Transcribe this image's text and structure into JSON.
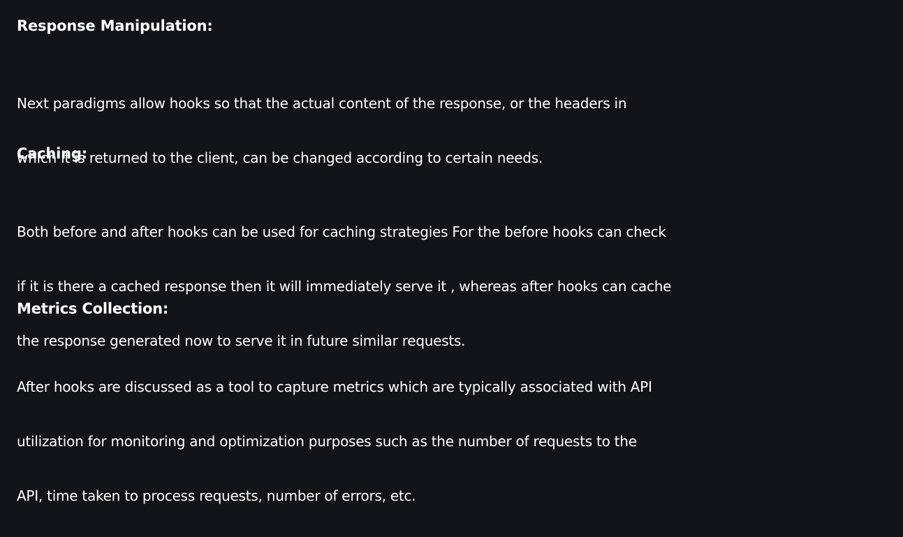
{
  "sections": [
    {
      "heading": "Response Manipulation:",
      "lines": [
        "Next paradigms allow hooks so that the actual content of the response, or the headers in",
        "which it is returned to the client, can be changed according to certain needs."
      ]
    },
    {
      "heading": "Caching:",
      "lines": [
        "Both before and after hooks can be used for caching strategies For the before hooks can check",
        "if it is there a cached response then it will immediately serve it , whereas after hooks can cache",
        "the response generated now to serve it in future similar requests."
      ]
    },
    {
      "heading": "Metrics Collection:",
      "lines": [
        "After hooks are discussed as a tool to capture metrics which are typically associated with API",
        "utilization for monitoring and optimization purposes such as the number of requests to the",
        "API, time taken to process requests, number of errors, etc."
      ]
    }
  ]
}
